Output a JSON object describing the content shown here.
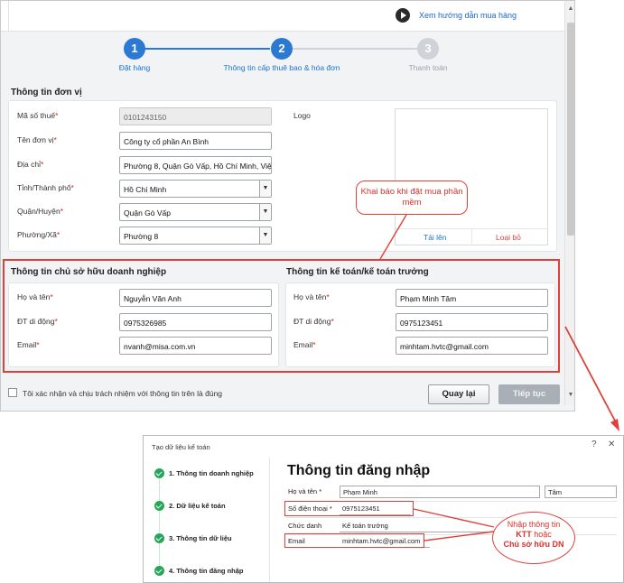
{
  "top_form": {
    "guide_link": "Xem hướng dẫn mua hàng",
    "steps": [
      {
        "number": "1",
        "label": "Đặt hàng",
        "state": "done"
      },
      {
        "number": "2",
        "label": "Thông tin cấp thuê bao & hóa đơn",
        "state": "active"
      },
      {
        "number": "3",
        "label": "Thanh toán",
        "state": "pending"
      }
    ],
    "unit_section": {
      "title": "Thông tin đơn vị",
      "tax_code": {
        "label": "Mã số thuế",
        "value": "0101243150"
      },
      "unit_name": {
        "label": "Tên đơn vị",
        "value": "Công ty cổ phần An Bình"
      },
      "address": {
        "label": "Địa chỉ",
        "value": "Phường 8, Quận Gò Vấp, Hồ Chí Minh, Việt Nam"
      },
      "province": {
        "label": "Tỉnh/Thành phố",
        "value": "Hồ Chí Minh"
      },
      "district": {
        "label": "Quận/Huyện",
        "value": "Quận Gò Vấp"
      },
      "ward": {
        "label": "Phường/Xã",
        "value": "Phường 8"
      },
      "logo_label": "Logo",
      "upload_label": "Tải lên",
      "remove_label": "Loại bỏ"
    },
    "owner_section": {
      "title": "Thông tin chủ sở hữu doanh nghiệp",
      "name": {
        "label": "Họ và tên",
        "value": "Nguyễn Văn Anh"
      },
      "phone": {
        "label": "ĐT di động",
        "value": "0975326985"
      },
      "email": {
        "label": "Email",
        "value": "nvanh@misa.com.vn"
      }
    },
    "accountant_section": {
      "title": "Thông tin kế toán/kế toán trưởng",
      "name": {
        "label": "Họ và tên",
        "value": "Phạm Minh Tâm"
      },
      "phone": {
        "label": "ĐT di động",
        "value": "0975123451"
      },
      "email": {
        "label": "Email",
        "value": "minhtam.hvtc@gmail.com"
      }
    },
    "required_mark": "*",
    "confirm_text": "Tôi xác nhận và chịu trách nhiệm với thông tin trên là đúng",
    "back_button": "Quay lại",
    "continue_button": "Tiếp tục",
    "callout": "Khai báo khi đặt mua phần mềm"
  },
  "bottom_form": {
    "window_title": "Tạo dữ liệu kế toán",
    "help_symbol": "?",
    "close_symbol": "✕",
    "sidebar": [
      {
        "label": "1. Thông tin doanh nghiệp"
      },
      {
        "label": "2. Dữ liệu kế toán"
      },
      {
        "label": "3. Thông tin dữ liệu"
      },
      {
        "label": "4. Thông tin đăng nhập"
      }
    ],
    "heading": "Thông tin đăng nhập",
    "name_label": "Họ và tên",
    "first_name": "Phạm Minh",
    "last_name": "Tâm",
    "phone_label": "Số điện thoại",
    "phone_value": "0975123451",
    "title_label": "Chức danh",
    "title_value": "Kế toán trưởng",
    "email_label": "Email",
    "email_value": "minhtam.hvtc@gmail.com",
    "required_mark": "*",
    "callout_prefix": "Nhập thông tin",
    "callout_ktt": "KTT",
    "callout_or": "hoặc",
    "callout_owner": "Chủ sở hữu DN"
  },
  "colors": {
    "accent_blue": "#1a73c9",
    "annotation_red": "#e0403a",
    "success_green": "#26a65b"
  }
}
